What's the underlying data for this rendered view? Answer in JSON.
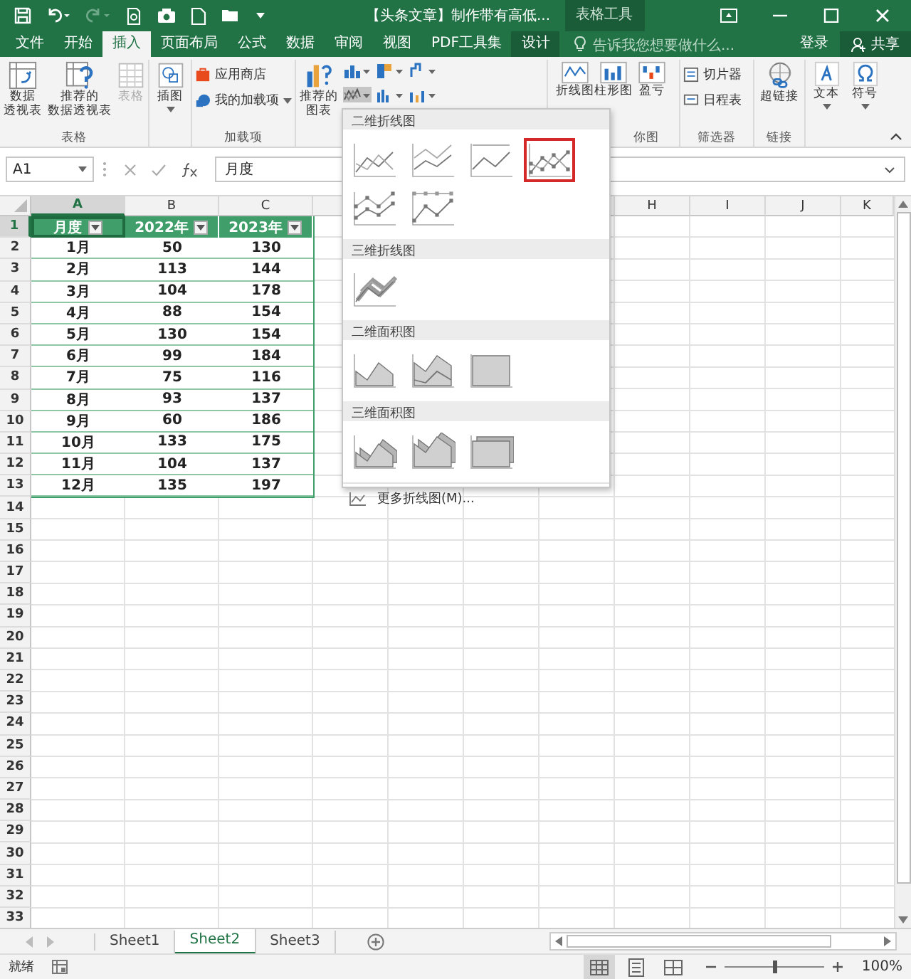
{
  "title_bar": {
    "title": "【头条文章】制作带有高低...",
    "context_label": "表格工具"
  },
  "tabs": [
    {
      "label": "文件",
      "selected": false,
      "kind": "normal"
    },
    {
      "label": "开始",
      "selected": false,
      "kind": "normal"
    },
    {
      "label": "插入",
      "selected": true,
      "kind": "normal"
    },
    {
      "label": "页面布局",
      "selected": false,
      "kind": "normal"
    },
    {
      "label": "公式",
      "selected": false,
      "kind": "normal"
    },
    {
      "label": "数据",
      "selected": false,
      "kind": "normal"
    },
    {
      "label": "审阅",
      "selected": false,
      "kind": "normal"
    },
    {
      "label": "视图",
      "selected": false,
      "kind": "normal"
    },
    {
      "label": "PDF工具集",
      "selected": false,
      "kind": "normal"
    },
    {
      "label": "设计",
      "selected": false,
      "kind": "context"
    }
  ],
  "tell_me": {
    "placeholder": "告诉我您想要做什么..."
  },
  "account": {
    "sign_in": "登录",
    "share": "共享"
  },
  "ribbon": {
    "table_group": {
      "label": "表格",
      "pivot": [
        "数据",
        "透视表"
      ],
      "recommended_pivot": [
        "推荐的",
        "数据透视表"
      ],
      "table": {
        "label": "表格",
        "disabled": true
      }
    },
    "illustrations": {
      "label": "插图"
    },
    "addins_group": {
      "label": "加载项",
      "store": "应用商店",
      "my_addins": "我的加载项"
    },
    "charts_group": {
      "recommended": [
        "推荐的",
        "图表"
      ]
    },
    "sparklines_group": {
      "label": "你图",
      "line": "折线图",
      "column": "柱形图",
      "win_loss": "盈亏"
    },
    "filters_group": {
      "label": "筛选器",
      "slicer": "切片器",
      "timeline": "日程表"
    },
    "links_group": {
      "label": "链接",
      "hyperlink": "超链接"
    },
    "text": "文本",
    "symbol": "符号"
  },
  "formula_bar": {
    "name_box": "A1",
    "content": "月度"
  },
  "column_headers": [
    {
      "label": "A",
      "selected": true
    },
    {
      "label": "B",
      "selected": false
    },
    {
      "label": "C",
      "selected": false
    }
  ],
  "column_headers_right": [
    "H",
    "I",
    "J",
    "K"
  ],
  "row_numbers": [
    {
      "label": "1",
      "selected": true
    },
    {
      "label": "2",
      "selected": false
    },
    {
      "label": "3",
      "selected": false
    },
    {
      "label": "4",
      "selected": false
    },
    {
      "label": "5",
      "selected": false
    },
    {
      "label": "6",
      "selected": false
    },
    {
      "label": "7",
      "selected": false
    },
    {
      "label": "8",
      "selected": false
    },
    {
      "label": "9",
      "selected": false
    },
    {
      "label": "10",
      "selected": false
    },
    {
      "label": "11",
      "selected": false
    },
    {
      "label": "12",
      "selected": false
    },
    {
      "label": "13",
      "selected": false
    },
    {
      "label": "14",
      "selected": false
    },
    {
      "label": "15",
      "selected": false
    },
    {
      "label": "16",
      "selected": false
    },
    {
      "label": "17",
      "selected": false
    },
    {
      "label": "18",
      "selected": false
    },
    {
      "label": "19",
      "selected": false
    },
    {
      "label": "20",
      "selected": false
    },
    {
      "label": "21",
      "selected": false
    },
    {
      "label": "22",
      "selected": false
    },
    {
      "label": "23",
      "selected": false
    },
    {
      "label": "24",
      "selected": false
    },
    {
      "label": "25",
      "selected": false
    },
    {
      "label": "26",
      "selected": false
    },
    {
      "label": "27",
      "selected": false
    },
    {
      "label": "28",
      "selected": false
    },
    {
      "label": "29",
      "selected": false
    },
    {
      "label": "30",
      "selected": false
    },
    {
      "label": "31",
      "selected": false
    },
    {
      "label": "32",
      "selected": false
    },
    {
      "label": "33",
      "selected": false
    }
  ],
  "table": {
    "columns": [
      "月度",
      "2022年",
      "2023年"
    ],
    "rows": [
      [
        "1月",
        "50",
        "130"
      ],
      [
        "2月",
        "113",
        "144"
      ],
      [
        "3月",
        "104",
        "178"
      ],
      [
        "4月",
        "88",
        "154"
      ],
      [
        "5月",
        "130",
        "154"
      ],
      [
        "6月",
        "99",
        "184"
      ],
      [
        "7月",
        "75",
        "116"
      ],
      [
        "8月",
        "93",
        "137"
      ],
      [
        "9月",
        "60",
        "186"
      ],
      [
        "10月",
        "133",
        "175"
      ],
      [
        "11月",
        "104",
        "137"
      ],
      [
        "12月",
        "135",
        "197"
      ]
    ]
  },
  "gallery": {
    "sections": [
      {
        "title": "二维折线图",
        "items": [
          {
            "kind": "line",
            "selected": false
          },
          {
            "kind": "stacked",
            "selected": false
          },
          {
            "kind": "percent",
            "selected": false
          },
          {
            "kind": "markers",
            "selected": true
          },
          {
            "kind": "stackedmarkers",
            "selected": false
          },
          {
            "kind": "percentmarkers",
            "selected": false
          }
        ]
      },
      {
        "title": "三维折线图",
        "items": [
          {
            "kind": "depthline",
            "selected": false
          }
        ]
      },
      {
        "title": "二维面积图",
        "items": [
          {
            "kind": "area",
            "selected": false
          },
          {
            "kind": "stackedarea",
            "selected": false
          },
          {
            "kind": "percentarea",
            "selected": false
          }
        ]
      },
      {
        "title": "三维面积图",
        "items": [
          {
            "kind": "deptharea",
            "selected": false
          },
          {
            "kind": "depthstacked",
            "selected": false
          },
          {
            "kind": "depthpercent",
            "selected": false
          }
        ]
      }
    ],
    "more": "更多折线图(M)..."
  },
  "sheets": [
    {
      "label": "Sheet1",
      "selected": false
    },
    {
      "label": "Sheet2",
      "selected": true
    },
    {
      "label": "Sheet3",
      "selected": false
    }
  ],
  "status_bar": {
    "status": "就绪",
    "views": [
      {
        "kind": "normal",
        "selected": true
      },
      {
        "kind": "layout",
        "selected": false
      },
      {
        "kind": "breaks",
        "selected": false
      }
    ],
    "zoom": {
      "level": 0.5,
      "reading": "100%"
    }
  }
}
